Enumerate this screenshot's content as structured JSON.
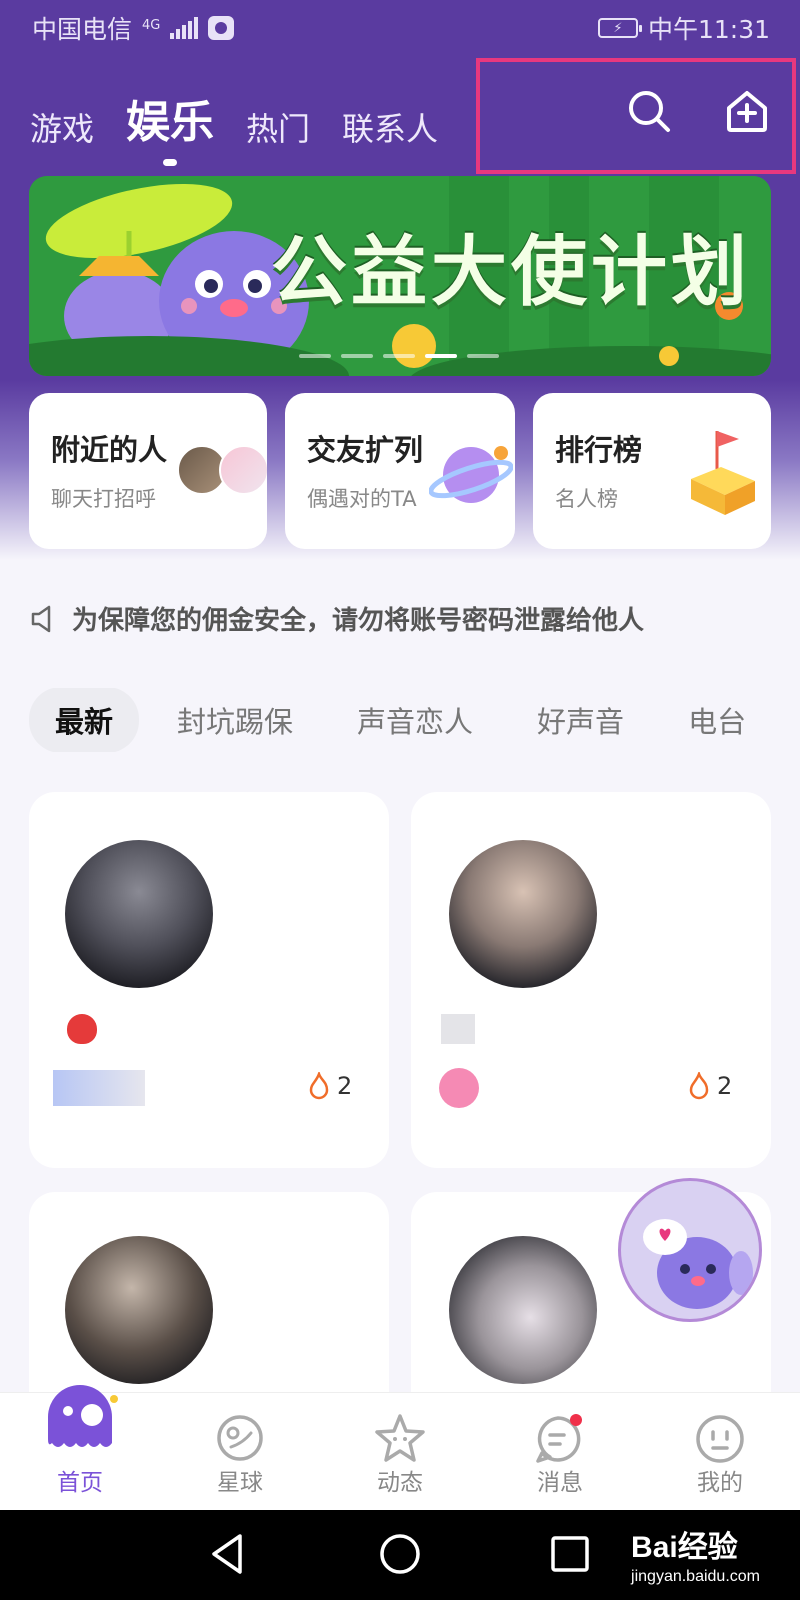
{
  "status_bar": {
    "carrier": "中国电信",
    "network": "4G",
    "time": "中午11:31"
  },
  "top_tabs": [
    {
      "label": "游戏",
      "active": false
    },
    {
      "label": "娱乐",
      "active": true
    },
    {
      "label": "热门",
      "active": false
    },
    {
      "label": "联系人",
      "active": false
    }
  ],
  "header_icons": {
    "search": "search-icon",
    "add": "add-home-icon"
  },
  "banner": {
    "title": "公益大使计划",
    "page_count": 5,
    "active_index": 3
  },
  "features": [
    {
      "title": "附近的人",
      "subtitle": "聊天打招呼"
    },
    {
      "title": "交友扩列",
      "subtitle": "偶遇对的TA"
    },
    {
      "title": "排行榜",
      "subtitle": "名人榜"
    }
  ],
  "notice": {
    "text": "为保障您的佣金安全，请勿将账号密码泄露给他人",
    "icon": "speaker-icon"
  },
  "categories": [
    {
      "label": "最新",
      "active": true
    },
    {
      "label": "封坑踢保",
      "active": false
    },
    {
      "label": "声音恋人",
      "active": false
    },
    {
      "label": "好声音",
      "active": false
    },
    {
      "label": "电台",
      "active": false
    }
  ],
  "cards": [
    {
      "hot": "2"
    },
    {
      "hot": "2"
    },
    {
      "hot": ""
    },
    {
      "hot": ""
    }
  ],
  "bottom_nav": [
    {
      "label": "首页",
      "active": true,
      "icon": "home-mascot-icon"
    },
    {
      "label": "星球",
      "active": false,
      "icon": "planet-icon"
    },
    {
      "label": "动态",
      "active": false,
      "icon": "star-face-icon"
    },
    {
      "label": "消息",
      "active": false,
      "icon": "message-icon",
      "badge": true
    },
    {
      "label": "我的",
      "active": false,
      "icon": "profile-face-icon"
    }
  ],
  "watermark": {
    "brand": "Bai经验",
    "url": "jingyan.baidu.com"
  },
  "colors": {
    "primary": "#5a3ba0",
    "accent": "#7b52d8",
    "highlight": "#e8387e",
    "hot": "#f06d2a"
  }
}
